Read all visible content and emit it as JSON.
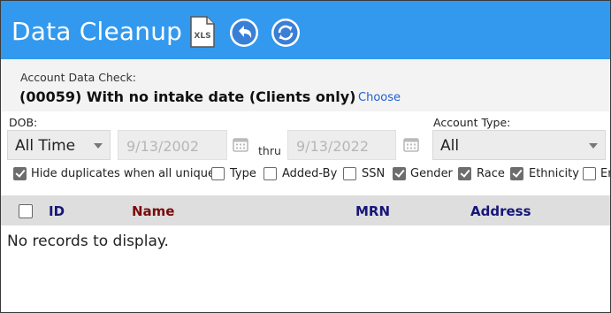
{
  "header": {
    "title": "Data Cleanup",
    "background": "#3399ee",
    "icons": [
      "xls-export-icon",
      "undo-icon",
      "refresh-icon"
    ]
  },
  "account_check": {
    "label": "Account Data Check:",
    "value": "(00059) With no intake date (Clients only)",
    "choose_label": "Choose"
  },
  "filters": {
    "dob_label": "DOB:",
    "dob_range": "All Time",
    "date_from": "9/13/2002",
    "thru_label": "thru",
    "date_to": "9/13/2022",
    "account_type_label": "Account Type:",
    "account_type": "All"
  },
  "options": [
    {
      "label": "Hide duplicates when all unique",
      "checked": true
    },
    {
      "label": "Type",
      "checked": false
    },
    {
      "label": "Added-By",
      "checked": false
    },
    {
      "label": "SSN",
      "checked": false
    },
    {
      "label": "Gender",
      "checked": true
    },
    {
      "label": "Race",
      "checked": true
    },
    {
      "label": "Ethnicity",
      "checked": true
    },
    {
      "label": "En",
      "checked": false
    }
  ],
  "grid": {
    "columns": [
      "ID",
      "Name",
      "MRN",
      "Address"
    ],
    "empty_message": "No records to display."
  }
}
